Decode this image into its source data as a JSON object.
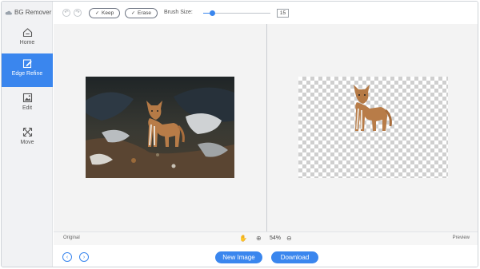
{
  "app": {
    "title": "BG Remover"
  },
  "sidebar": {
    "items": [
      {
        "label": "Home",
        "icon": "home-icon",
        "active": false
      },
      {
        "label": "Edge Refine",
        "icon": "edge-refine-icon",
        "active": true
      },
      {
        "label": "Edit",
        "icon": "edit-image-icon",
        "active": false
      },
      {
        "label": "Move",
        "icon": "move-icon",
        "active": false
      }
    ]
  },
  "toolbar": {
    "keep_label": "Keep",
    "erase_label": "Erase",
    "brush_size_label": "Brush Size:",
    "brush_size_value": "15",
    "brush_size_level": 0.13
  },
  "status": {
    "original_label": "Original",
    "preview_label": "Preview",
    "zoom": "54%"
  },
  "bottom": {
    "new_image_label": "New Image",
    "download_label": "Download"
  },
  "colors": {
    "accent": "#3a86ee",
    "panel": "#f3f3f3",
    "sidebar": "#f1f2f4"
  }
}
